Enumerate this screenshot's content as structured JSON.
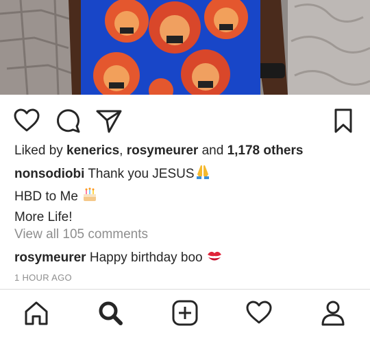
{
  "post": {
    "likes": {
      "prefix": "Liked by ",
      "user1": "kenerics",
      "separator": ", ",
      "user2": "rosymeurer",
      "conjunction": " and ",
      "others": "1,178 others"
    },
    "caption": {
      "username": "nonsodiobi",
      "line1": "Thank you JESUS",
      "line2": "HBD to Me",
      "line3": "More Life!"
    },
    "view_all_comments": "View all 105 comments",
    "comment": {
      "username": "rosymeurer",
      "text": "Happy birthday boo"
    },
    "timestamp": "1 HOUR AGO"
  },
  "icons": {
    "action_bar": [
      "heart-outline-icon",
      "comment-icon",
      "share-paper-plane-icon",
      "bookmark-icon"
    ],
    "emojis": [
      "praying-hands-emoji",
      "birthday-cake-emoji",
      "kiss-mark-emoji"
    ],
    "bottom_nav": [
      "home-icon",
      "search-icon",
      "add-post-icon",
      "activity-heart-icon",
      "profile-icon"
    ]
  },
  "colors": {
    "text": "#262626",
    "muted": "#8e8e8e",
    "divider": "#dbdbdb",
    "shirt_blue": "#1846c8",
    "shirt_orange": "#e4572e"
  }
}
